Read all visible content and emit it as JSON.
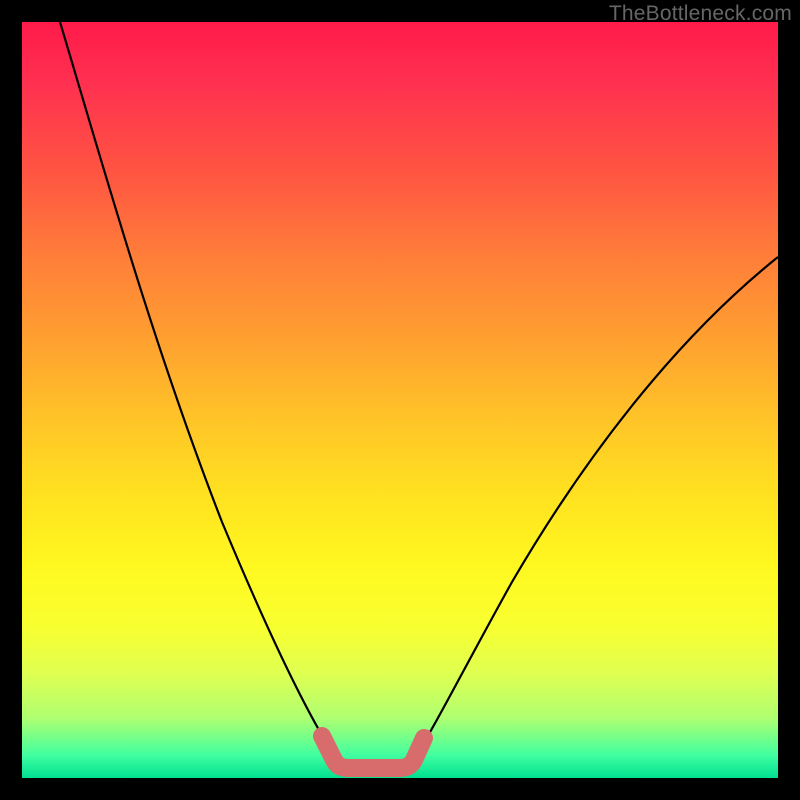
{
  "watermark": "TheBottleneck.com",
  "chart_data": {
    "type": "line",
    "title": "",
    "xlabel": "",
    "ylabel": "",
    "xlim": [
      0,
      100
    ],
    "ylim": [
      0,
      100
    ],
    "series": [
      {
        "name": "left-curve",
        "x": [
          5,
          10,
          15,
          20,
          25,
          30,
          35,
          38,
          40,
          42
        ],
        "values": [
          100,
          85,
          68,
          52,
          38,
          25,
          14,
          7,
          3,
          1
        ]
      },
      {
        "name": "right-curve",
        "x": [
          50,
          52,
          55,
          60,
          65,
          70,
          75,
          80,
          85,
          90,
          95,
          100
        ],
        "values": [
          1,
          3,
          8,
          17,
          26,
          34,
          42,
          49,
          55,
          60,
          65,
          69
        ]
      },
      {
        "name": "bottom-flat",
        "x": [
          40,
          42,
          44,
          46,
          48,
          50,
          52
        ],
        "values": [
          2,
          1,
          1,
          1,
          1,
          1,
          2
        ]
      }
    ],
    "highlight": {
      "name": "optimal-zone",
      "x": [
        40,
        42,
        44,
        46,
        48,
        50,
        52
      ],
      "values": [
        3,
        1,
        1,
        1,
        1,
        1,
        3
      ],
      "color": "#d86b6b"
    }
  }
}
